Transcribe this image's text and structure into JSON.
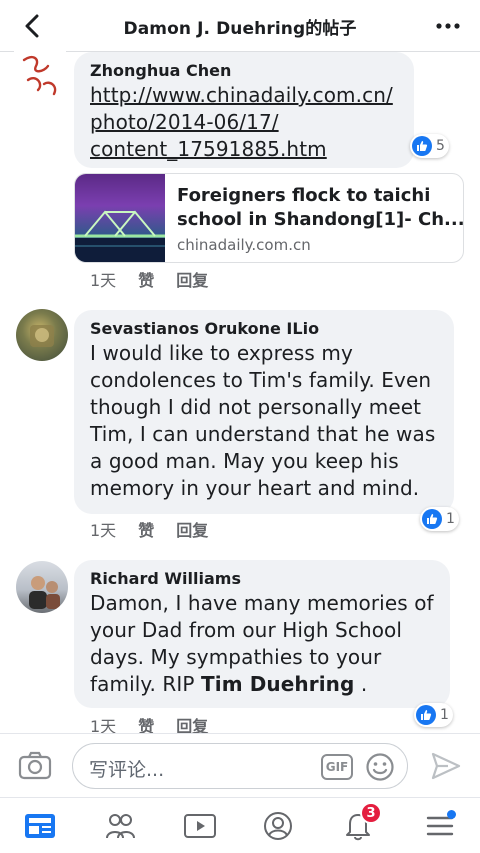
{
  "header": {
    "title": "Damon J. Duehring的帖子"
  },
  "comments": [
    {
      "name": "Zhonghua Chen",
      "link_lines": [
        "http://www.chinadaily.com.cn/",
        "photo/2014-06/17/",
        "content_17591885.htm"
      ],
      "reactions": "5",
      "preview": {
        "title_line1": "Foreigners flock to taichi",
        "title_line2": "school in Shandong[1]- Ch...",
        "domain": "chinadaily.com.cn"
      },
      "time": "1天",
      "like": "赞",
      "reply": "回复"
    },
    {
      "name": "Sevastianos Orukone ILio",
      "text_lines": [
        "I would like to express my",
        "condolences to Tim's family. Even",
        "though I did not personally meet",
        "Tim, I can understand that he was",
        "a good man. May you keep his",
        "memory in your heart and mind."
      ],
      "reactions": "1",
      "time": "1天",
      "like": "赞",
      "reply": "回复"
    },
    {
      "name": "Richard Williams",
      "text_lines": [
        "Damon, I have many memories of",
        "your Dad from our High School",
        "days. My sympathies to your"
      ],
      "text_last_prefix": "family. RIP ",
      "text_last_bold": "Tim Duehring",
      "text_last_suffix": " .",
      "reactions": "1",
      "time": "1天",
      "like": "赞",
      "reply": "回复"
    }
  ],
  "composer": {
    "placeholder": "写评论...",
    "gif_label": "GIF"
  },
  "nav": {
    "notifications_count": "3"
  },
  "colors": {
    "accent": "#1877f2",
    "bubble": "#f0f2f5",
    "badge": "#e41e3f"
  }
}
